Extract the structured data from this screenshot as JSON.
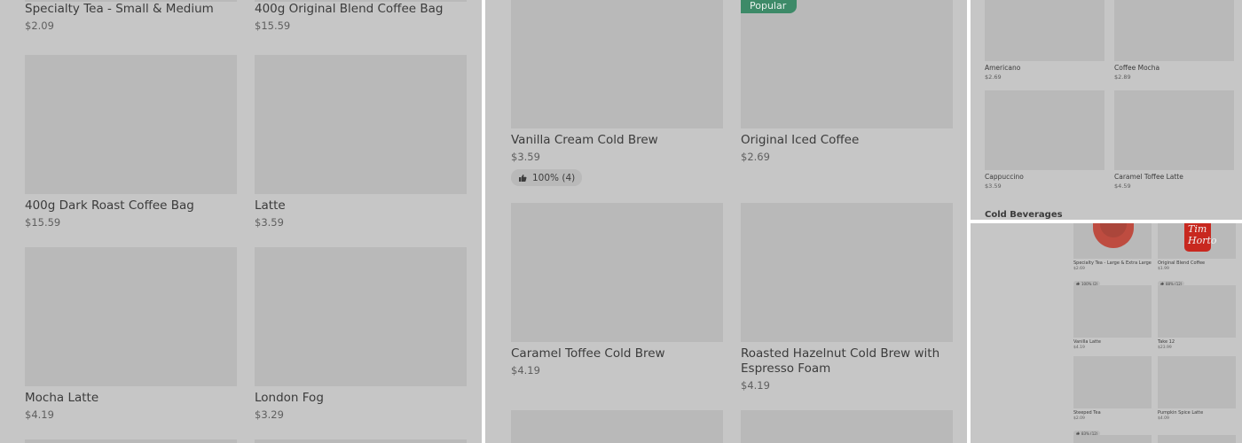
{
  "panel1": {
    "items": [
      {
        "name": "Specialty Tea - Small & Medium",
        "price": "$2.09"
      },
      {
        "name": "400g Original Blend Coffee Bag",
        "price": "$15.59"
      },
      {
        "name": "400g Dark Roast Coffee Bag",
        "price": "$15.59"
      },
      {
        "name": "Latte",
        "price": "$3.59"
      },
      {
        "name": "Mocha Latte",
        "price": "$4.19"
      },
      {
        "name": "London Fog",
        "price": "$3.29"
      }
    ]
  },
  "panel2": {
    "popular_label": "Popular",
    "items": [
      {
        "name": "Vanilla Cream Cold Brew",
        "price": "$3.59",
        "rating": "100% (4)"
      },
      {
        "name": "Original Iced Coffee",
        "price": "$2.69"
      },
      {
        "name": "Caramel Toffee Cold Brew",
        "price": "$4.19"
      },
      {
        "name": "Roasted Hazelnut Cold Brew with",
        "name2": "Espresso Foam",
        "price": "$4.19"
      }
    ]
  },
  "panel3": {
    "section_title": "Cold Beverages",
    "items": [
      {
        "name": "Americano",
        "price": "$2.69"
      },
      {
        "name": "Coffee Mocha",
        "price": "$2.89"
      },
      {
        "name": "Cappuccino",
        "price": "$3.59"
      },
      {
        "name": "Caramel Toffee Latte",
        "price": "$4.59"
      }
    ]
  },
  "panel4": {
    "cup_text": "Tim Horto",
    "items": [
      {
        "name": "Specialty Tea - Large & Extra Large",
        "price": "$2.69",
        "rating": "100% (2)"
      },
      {
        "name": "Original Blend Coffee",
        "price": "$1.99",
        "rating": "88% (12)"
      },
      {
        "name": "Vanilla Latte",
        "price": "$4.19"
      },
      {
        "name": "Take 12",
        "price": "$23.99"
      },
      {
        "name": "Steeped Tea",
        "price": "$2.09",
        "rating": "83% (12)"
      },
      {
        "name": "Pumpkin Spice Latte",
        "price": "$4.09"
      }
    ]
  },
  "icons": {
    "thumbs_up": "thumbs-up-icon"
  },
  "colors": {
    "background": "#c6c6c6",
    "image_placeholder": "#b9b9b9",
    "popular_badge": "#3d8a68"
  }
}
